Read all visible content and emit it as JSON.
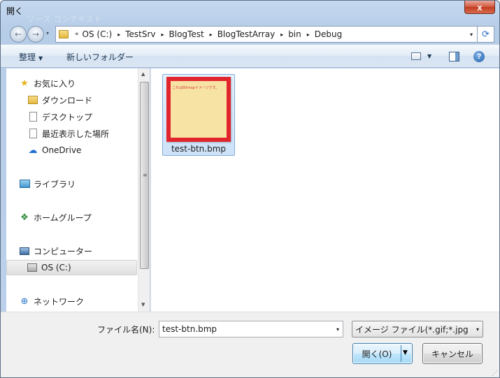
{
  "window": {
    "title": "開く",
    "ghost_title": "ソース コンテキスト",
    "close_label": "x"
  },
  "nav": {
    "back_icon": "←",
    "forward_icon": "→",
    "history_caret": "▾",
    "breadcrumb_lead": "«",
    "breadcrumbs": [
      "OS (C:)",
      "TestSrv",
      "BlogTest",
      "BlogTestArray",
      "bin",
      "Debug"
    ],
    "separator": "▸",
    "address_caret": "▾",
    "refresh_icon": "⟳"
  },
  "toolbar": {
    "organize_label": "整理",
    "organize_caret": "▼",
    "new_folder_label": "新しいフォルダー",
    "views_caret": "▼",
    "help_label": "?"
  },
  "sidebar": {
    "favorites": {
      "label": "お気に入り",
      "icon": "star-icon",
      "glyph": "★"
    },
    "items": [
      {
        "label": "ダウンロード",
        "icon": "downloads-folder-icon"
      },
      {
        "label": "デスクトップ",
        "icon": "desktop-icon"
      },
      {
        "label": "最近表示した場所",
        "icon": "recent-places-icon"
      },
      {
        "label": "OneDrive",
        "icon": "onedrive-icon",
        "glyph": "☁"
      }
    ],
    "libraries": {
      "label": "ライブラリ",
      "icon": "libraries-icon"
    },
    "homegroup": {
      "label": "ホームグループ",
      "icon": "homegroup-icon",
      "glyph": "❖"
    },
    "computer": {
      "label": "コンピューター",
      "icon": "computer-icon"
    },
    "drive": {
      "label": "OS (C:)",
      "icon": "drive-icon"
    },
    "network": {
      "label": "ネットワーク",
      "icon": "network-icon",
      "glyph": "⊕"
    }
  },
  "scrollbar": {
    "up": "▲",
    "down": "▼",
    "grip": "≡"
  },
  "files": [
    {
      "name": "test-btn.bmp",
      "thumb_text": "これはBitmapイメージです。"
    }
  ],
  "footer": {
    "filename_label": "ファイル名(N):",
    "filename_value": "test-btn.bmp",
    "filename_caret": "▾",
    "filetype_value": "イメージ ファイル(*.gif;*.jpg",
    "filetype_caret": "▾",
    "open_label": "開く(O)",
    "open_caret": "▼",
    "cancel_label": "キャンセル",
    "resize_grip": "⋰"
  },
  "colors": {
    "accent": "#3c7fb1",
    "thumbnail_border": "#e2252d",
    "thumbnail_fill": "#f7e4a5"
  }
}
